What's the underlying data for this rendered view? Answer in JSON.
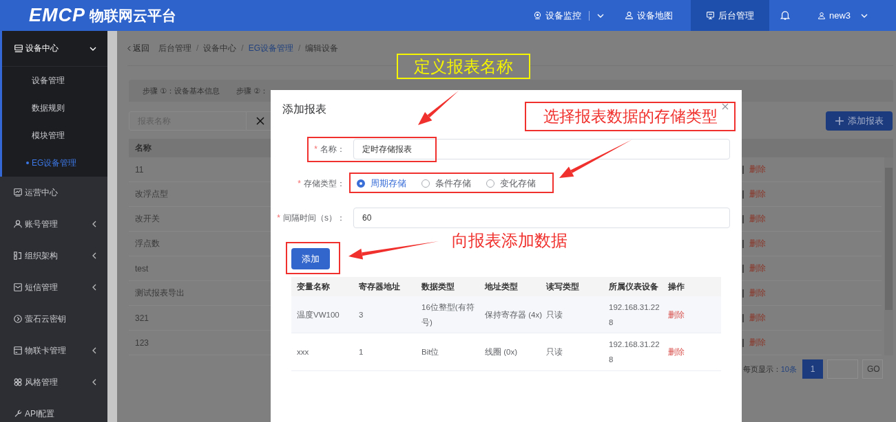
{
  "header": {
    "logo": "EMCP",
    "title": "物联网云平台",
    "nav": [
      {
        "label": "设备监控",
        "kind": "dropdown",
        "selected": false
      },
      {
        "label": "设备地图",
        "kind": "link",
        "selected": false
      },
      {
        "label": "后台管理",
        "kind": "link",
        "selected": true
      }
    ],
    "user": "new3"
  },
  "sidebar": {
    "items": [
      {
        "label": "设备中心",
        "kind": "group",
        "expanded": true,
        "children": [
          {
            "label": "设备管理",
            "selected": false
          },
          {
            "label": "数据规则",
            "selected": false
          },
          {
            "label": "模块管理",
            "selected": false
          },
          {
            "label": "EG设备管理",
            "selected": true
          }
        ]
      },
      {
        "label": "运营中心",
        "kind": "link"
      },
      {
        "label": "账号管理",
        "kind": "group",
        "expanded": false
      },
      {
        "label": "组织架构",
        "kind": "group",
        "expanded": false
      },
      {
        "label": "短信管理",
        "kind": "group",
        "expanded": false
      },
      {
        "label": "萤石云密钥",
        "kind": "link"
      },
      {
        "label": "物联卡管理",
        "kind": "group",
        "expanded": false
      },
      {
        "label": "风格管理",
        "kind": "group",
        "expanded": false
      },
      {
        "label": "API配置",
        "kind": "link"
      }
    ]
  },
  "breadcrumb": {
    "back": "返回",
    "separator": "/",
    "items": [
      {
        "label": "后台管理",
        "kind": "text"
      },
      {
        "label": "设备中心",
        "kind": "text"
      },
      {
        "label": "EG设备管理",
        "kind": "link"
      },
      {
        "label": "编辑设备",
        "kind": "text"
      }
    ]
  },
  "steps": [
    {
      "label": "步骤 ①：设备基本信息",
      "selected": false
    },
    {
      "label": "步骤 ②：",
      "selected": false
    }
  ],
  "search": {
    "placeholder": "报表名称"
  },
  "add_report_button": "添加报表",
  "table": {
    "columns": [
      "名称"
    ],
    "rows": [
      {
        "name": "11",
        "action": "删除"
      },
      {
        "name": "改浮点型",
        "action": "删除"
      },
      {
        "name": "改开关",
        "action": "删除"
      },
      {
        "name": "浮点数",
        "action": "删除"
      },
      {
        "name": "test",
        "action": "删除"
      },
      {
        "name": "测试报表导出",
        "action": "删除"
      },
      {
        "name": "321",
        "action": "删除"
      },
      {
        "name": "123",
        "action": "删除"
      }
    ]
  },
  "pagination": {
    "page_size_label": "每页显示：",
    "page_size": "10条",
    "pages": [
      {
        "label": "1",
        "selected": true
      }
    ],
    "go": "GO"
  },
  "dialog": {
    "title": "添加报表",
    "required_mark": "*",
    "fields": [
      {
        "kind": "text",
        "label": "名称：",
        "required": true,
        "value": "定时存储报表"
      },
      {
        "kind": "radio",
        "label": "存储类型：",
        "required": true,
        "options": [
          {
            "label": "周期存储",
            "selected": true
          },
          {
            "label": "条件存储",
            "selected": false
          },
          {
            "label": "变化存储",
            "selected": false
          }
        ]
      },
      {
        "kind": "text",
        "label": "间隔时间（s）：",
        "required": true,
        "value": "60"
      }
    ],
    "add_button": "添加",
    "table": {
      "columns": [
        "变量名称",
        "寄存器地址",
        "数据类型",
        "地址类型",
        "读写类型",
        "所属仪表设备",
        "操作"
      ],
      "rows": [
        {
          "cells": [
            "温度VW100",
            "3",
            "16位整型(有符号)",
            "保持寄存器 (4x)",
            "只读",
            "192.168.31.228"
          ],
          "action": "删除"
        },
        {
          "cells": [
            "xxx",
            "1",
            "Bit位",
            "线圈 (0x)",
            "只读",
            "192.168.31.228"
          ],
          "action": "删除"
        }
      ]
    }
  },
  "annotations": [
    {
      "kind": "yellow_box",
      "text": "定义报表名称"
    },
    {
      "kind": "red_box",
      "text": "选择报表数据的存储类型"
    },
    {
      "kind": "red_text",
      "text": "向报表添加数据"
    }
  ]
}
